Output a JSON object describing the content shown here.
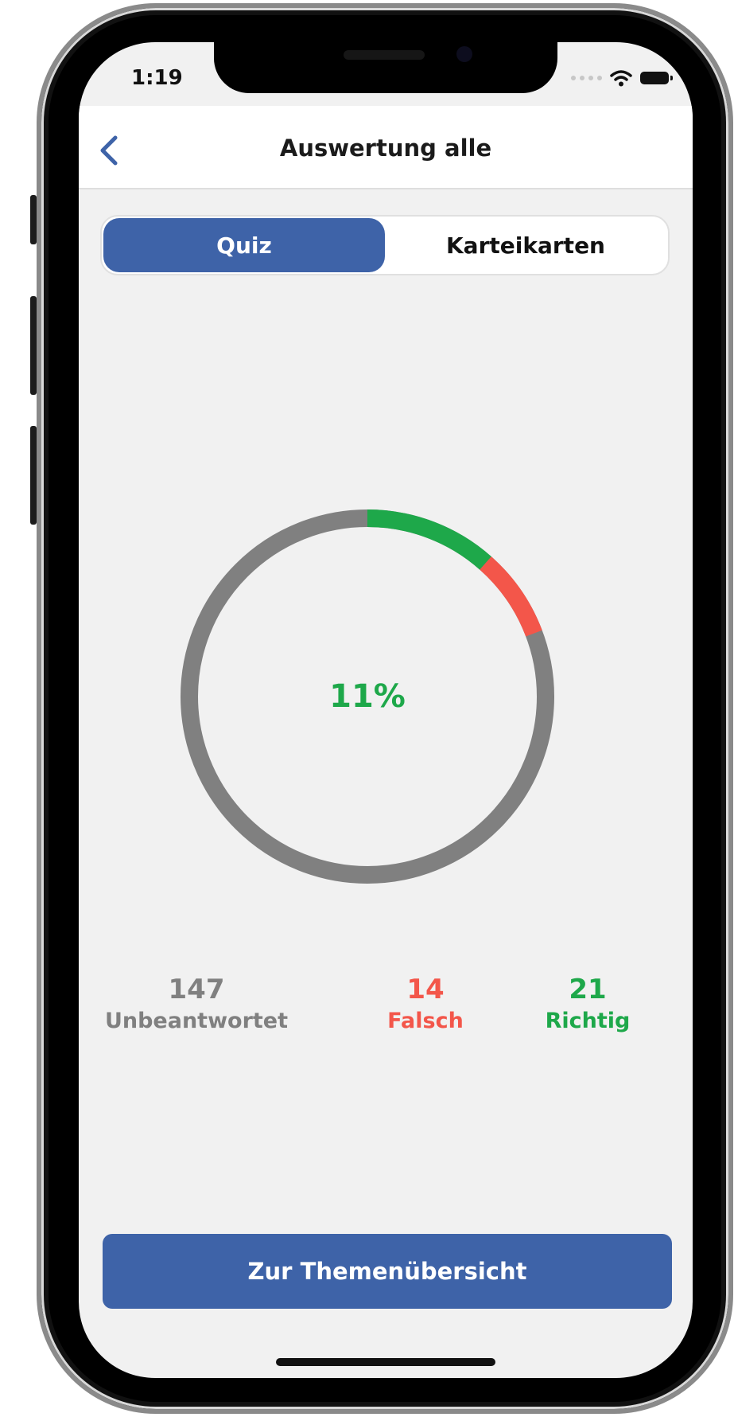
{
  "status_bar": {
    "time": "1:19"
  },
  "nav": {
    "title": "Auswertung alle"
  },
  "segments": [
    {
      "label": "Quiz",
      "selected": true
    },
    {
      "label": "Karteikarten",
      "selected": false
    }
  ],
  "progress": {
    "percent_label": "11%",
    "unanswered": 147,
    "wrong": 14,
    "correct": 21
  },
  "stats": {
    "unanswered": {
      "count": "147",
      "label": "Unbeantwortet"
    },
    "wrong": {
      "count": "14",
      "label": "Falsch"
    },
    "correct": {
      "count": "21",
      "label": "Richtig"
    }
  },
  "colors": {
    "accent": "#3e63a8",
    "correct": "#1ea84a",
    "wrong": "#f3564a",
    "unanswered": "#808080",
    "screen_bg": "#f1f1f1"
  },
  "icons": {
    "back": "chevron-left-icon",
    "wifi": "wifi-icon",
    "battery": "battery-icon"
  },
  "button": {
    "label": "Zur Themenübersicht"
  }
}
